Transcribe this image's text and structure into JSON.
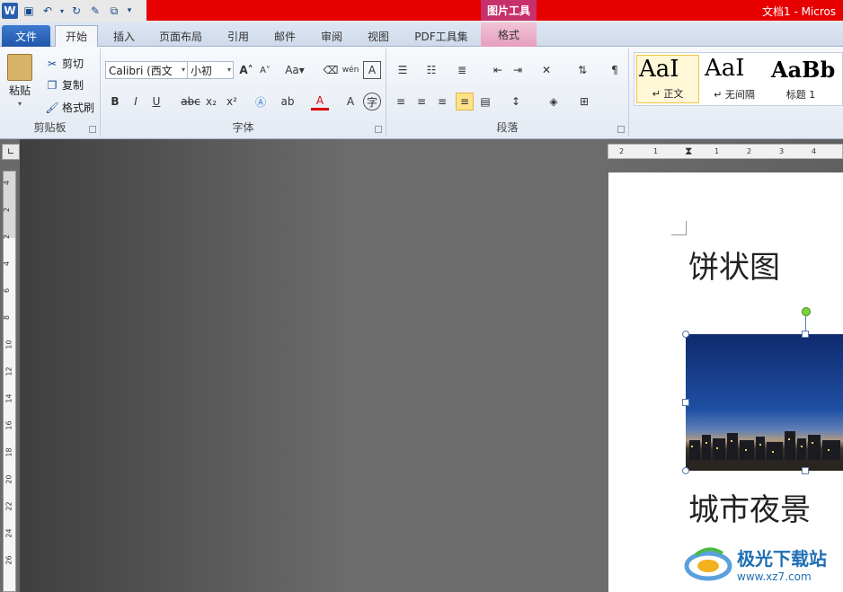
{
  "titlebar": {
    "context_tab_group": "图片工具",
    "window_title": "文档1 - Micros"
  },
  "tabs": {
    "file": "文件",
    "items": [
      "开始",
      "插入",
      "页面布局",
      "引用",
      "邮件",
      "审阅",
      "视图",
      "PDF工具集"
    ],
    "context_tab": "格式",
    "active": "开始"
  },
  "clipboard": {
    "paste": "粘贴",
    "cut": "剪切",
    "copy": "复制",
    "format_painter": "格式刷",
    "label": "剪贴板"
  },
  "font": {
    "family": "Calibri (西文",
    "size": "小初",
    "label": "字体",
    "bold": "B",
    "italic": "I",
    "underline": "U",
    "strike": "abc",
    "grow": "A",
    "shrink": "A",
    "case": "Aa",
    "clear": "A",
    "phonetic": "wén",
    "color_a": "A"
  },
  "paragraph": {
    "label": "段落"
  },
  "styles": {
    "items": [
      {
        "sample": "AaI",
        "name": "↵ 正文"
      },
      {
        "sample": "AaI",
        "name": "↵ 无间隔"
      },
      {
        "sample": "AaBb",
        "name": "标题 1"
      }
    ]
  },
  "ruler": {
    "h_ticks": [
      "2",
      "1",
      "1",
      "2",
      "3",
      "4"
    ],
    "v_ticks": [
      "4",
      "2",
      "2",
      "4",
      "6",
      "8",
      "10",
      "12",
      "14",
      "16",
      "18",
      "20",
      "22",
      "24",
      "26"
    ]
  },
  "document": {
    "heading": "饼状图",
    "caption": "城市夜景"
  },
  "watermark": {
    "text": "极光下载站",
    "url": "www.xz7.com"
  }
}
